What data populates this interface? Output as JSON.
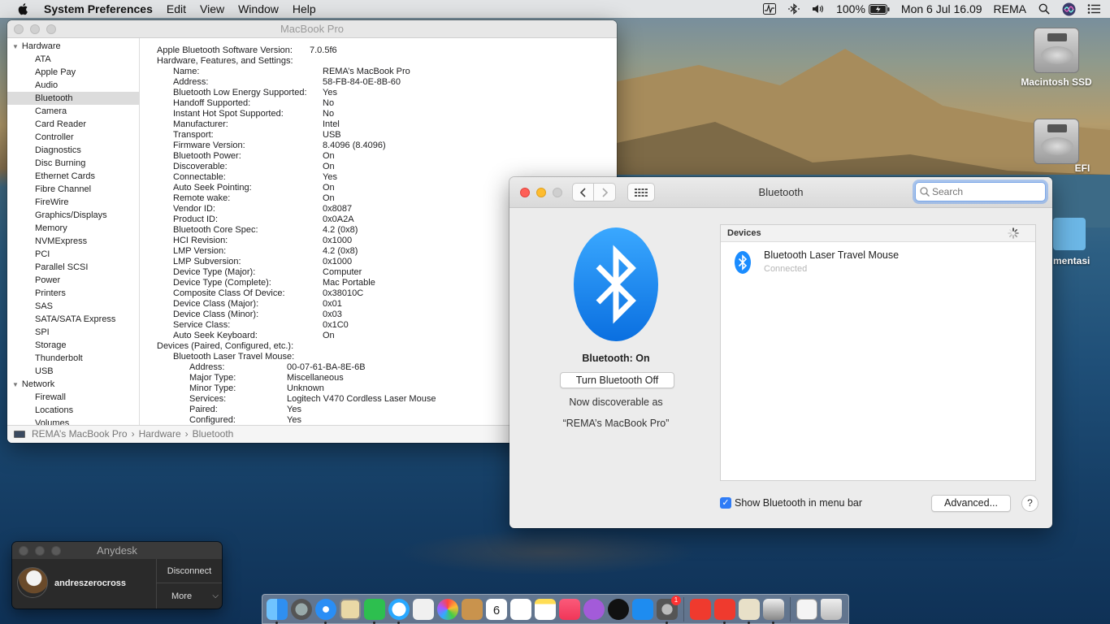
{
  "menubar": {
    "app_name": "System Preferences",
    "items": [
      "Edit",
      "View",
      "Window",
      "Help"
    ],
    "battery": "100%",
    "datetime": "Mon 6 Jul  16.09",
    "user": "REMA"
  },
  "desktop": {
    "icons": [
      {
        "label": "Macintosh SSD"
      },
      {
        "label": "EFI"
      },
      {
        "label": "mentasi"
      }
    ]
  },
  "sysinfo": {
    "title": "MacBook Pro",
    "sidebar": {
      "hardware_label": "Hardware",
      "hardware_items": [
        "ATA",
        "Apple Pay",
        "Audio",
        "Bluetooth",
        "Camera",
        "Card Reader",
        "Controller",
        "Diagnostics",
        "Disc Burning",
        "Ethernet Cards",
        "Fibre Channel",
        "FireWire",
        "Graphics/Displays",
        "Memory",
        "NVMExpress",
        "PCI",
        "Parallel SCSI",
        "Power",
        "Printers",
        "SAS",
        "SATA/SATA Express",
        "SPI",
        "Storage",
        "Thunderbolt",
        "USB"
      ],
      "selected": "Bluetooth",
      "network_label": "Network",
      "network_items": [
        "Firewall",
        "Locations",
        "Volumes"
      ]
    },
    "content": {
      "version_key": "Apple Bluetooth Software Version:",
      "version_value": "7.0.5f6",
      "section1": "Hardware, Features, and Settings:",
      "props": [
        {
          "k": "Name:",
          "v": "REMA’s MacBook Pro"
        },
        {
          "k": "Address:",
          "v": "58-FB-84-0E-8B-60"
        },
        {
          "k": "Bluetooth Low Energy Supported:",
          "v": "Yes"
        },
        {
          "k": "Handoff Supported:",
          "v": "No"
        },
        {
          "k": "Instant Hot Spot Supported:",
          "v": "No"
        },
        {
          "k": "Manufacturer:",
          "v": "Intel"
        },
        {
          "k": "Transport:",
          "v": "USB"
        },
        {
          "k": "Firmware Version:",
          "v": "8.4096 (8.4096)"
        },
        {
          "k": "Bluetooth Power:",
          "v": "On"
        },
        {
          "k": "Discoverable:",
          "v": "On"
        },
        {
          "k": "Connectable:",
          "v": "Yes"
        },
        {
          "k": "Auto Seek Pointing:",
          "v": "On"
        },
        {
          "k": "Remote wake:",
          "v": "On"
        },
        {
          "k": "Vendor ID:",
          "v": "0x8087"
        },
        {
          "k": "Product ID:",
          "v": "0x0A2A"
        },
        {
          "k": "Bluetooth Core Spec:",
          "v": "4.2 (0x8)"
        },
        {
          "k": "HCI Revision:",
          "v": "0x1000"
        },
        {
          "k": "LMP Version:",
          "v": "4.2 (0x8)"
        },
        {
          "k": "LMP Subversion:",
          "v": "0x1000"
        },
        {
          "k": "Device Type (Major):",
          "v": "Computer"
        },
        {
          "k": "Device Type (Complete):",
          "v": "Mac Portable"
        },
        {
          "k": "Composite Class Of Device:",
          "v": "0x38010C"
        },
        {
          "k": "Device Class (Major):",
          "v": "0x01"
        },
        {
          "k": "Device Class (Minor):",
          "v": "0x03"
        },
        {
          "k": "Service Class:",
          "v": "0x1C0"
        },
        {
          "k": "Auto Seek Keyboard:",
          "v": "On"
        }
      ],
      "section2": "Devices (Paired, Configured, etc.):",
      "device_name": "Bluetooth Laser Travel Mouse:",
      "device_props": [
        {
          "k": "Address:",
          "v": "00-07-61-BA-8E-6B"
        },
        {
          "k": "Major Type:",
          "v": "Miscellaneous"
        },
        {
          "k": "Minor Type:",
          "v": "Unknown"
        },
        {
          "k": "Services:",
          "v": "Logitech V470 Cordless Laser Mouse"
        },
        {
          "k": "Paired:",
          "v": "Yes"
        },
        {
          "k": "Configured:",
          "v": "Yes"
        }
      ]
    },
    "pathbar": [
      "REMA’s MacBook Pro",
      "Hardware",
      "Bluetooth"
    ]
  },
  "bluetooth": {
    "title": "Bluetooth",
    "search_placeholder": "Search",
    "status": "Bluetooth: On",
    "toggle_label": "Turn Bluetooth Off",
    "discoverable_line1": "Now discoverable as",
    "discoverable_line2": "“REMA’s MacBook Pro”",
    "devices_header": "Devices",
    "devices": [
      {
        "name": "Bluetooth Laser Travel Mouse",
        "status": "Connected"
      }
    ],
    "show_in_menubar_label": "Show Bluetooth in menu bar",
    "show_in_menubar_checked": true,
    "advanced_label": "Advanced...",
    "help_label": "?",
    "accent_color": "#1a8cff"
  },
  "anydesk": {
    "title": "Anydesk",
    "user": "andreszerocross",
    "disconnect_label": "Disconnect",
    "more_label": "More"
  },
  "dock": {
    "calendar_day": "6",
    "appstore_badge": "1"
  }
}
